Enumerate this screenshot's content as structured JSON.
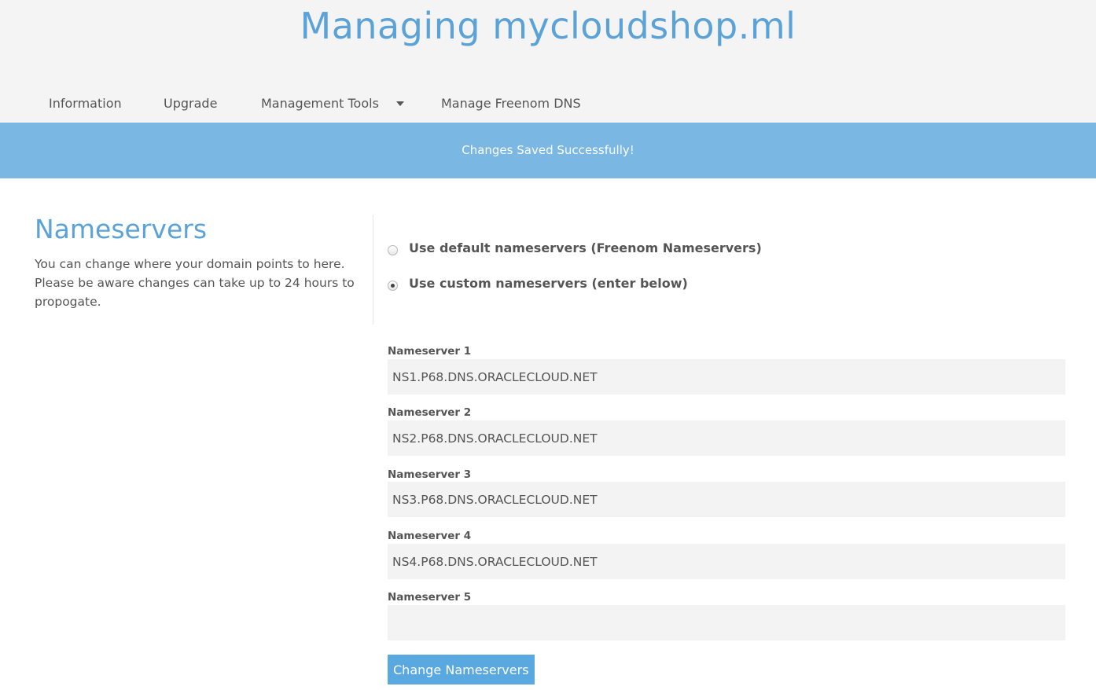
{
  "header": {
    "title": "Managing mycloudshop.ml"
  },
  "nav": {
    "items": [
      {
        "label": "Information"
      },
      {
        "label": "Upgrade"
      },
      {
        "label": "Management Tools",
        "has_dropdown": true
      },
      {
        "label": "Manage Freenom DNS"
      }
    ]
  },
  "banner": {
    "message": "Changes Saved Successfully!"
  },
  "nameservers_section": {
    "title": "Nameservers",
    "description": "You can change where your domain points to here. Please be aware changes can take up to 24 hours to propogate."
  },
  "options": {
    "default_label": "Use default nameservers (Freenom Nameservers)",
    "default_checked": false,
    "custom_label": "Use custom nameservers (enter below)",
    "custom_checked": true
  },
  "fields": [
    {
      "label": "Nameserver 1",
      "value": "NS1.P68.DNS.ORACLECLOUD.NET"
    },
    {
      "label": "Nameserver 2",
      "value": "NS2.P68.DNS.ORACLECLOUD.NET"
    },
    {
      "label": "Nameserver 3",
      "value": "NS3.P68.DNS.ORACLECLOUD.NET"
    },
    {
      "label": "Nameserver 4",
      "value": "NS4.P68.DNS.ORACLECLOUD.NET"
    },
    {
      "label": "Nameserver 5",
      "value": ""
    }
  ],
  "submit_label": "Change Nameservers",
  "colors": {
    "accent": "#5aa2d8",
    "banner": "#7ab7e3",
    "button": "#5aa8e0",
    "header_bg": "#f4f4f4",
    "input_bg": "#f3f3f3"
  }
}
